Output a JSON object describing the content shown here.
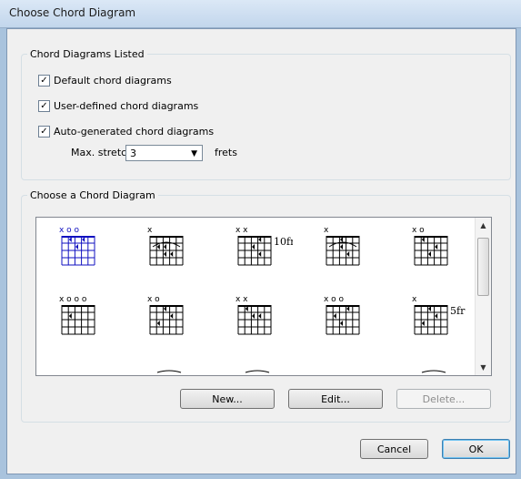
{
  "window": {
    "title": "Choose Chord Diagram"
  },
  "listed_group": {
    "legend": "Chord Diagrams Listed",
    "options": [
      {
        "label": "Default chord diagrams",
        "checked": true
      },
      {
        "label": "User-defined chord diagrams",
        "checked": true
      },
      {
        "label": "Auto-generated chord diagrams",
        "checked": true
      }
    ],
    "max_stretch_label": "Max. stretch:",
    "max_stretch_value": "3",
    "frets_label": "frets"
  },
  "choose_group": {
    "legend": "Choose a Chord Diagram",
    "fret_labels": [
      "10fr",
      "5fr"
    ],
    "selected_index": 0
  },
  "buttons": {
    "new": "New...",
    "edit": "Edit...",
    "delete": "Delete...",
    "cancel": "Cancel",
    "ok": "OK"
  },
  "colors": {
    "selected_chord": "#1010c0",
    "chord": "#000000"
  }
}
